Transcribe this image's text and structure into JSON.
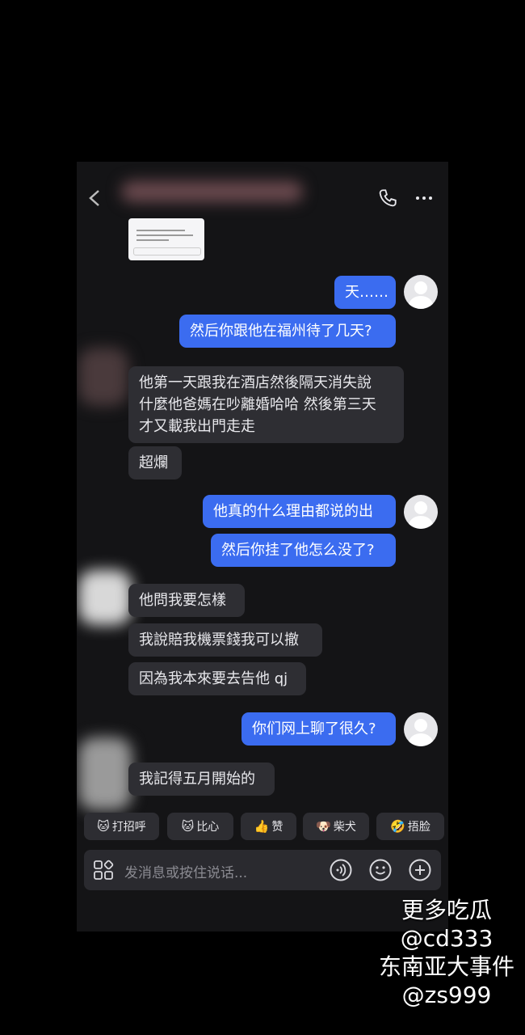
{
  "header": {
    "call_icon": "phone-icon",
    "more_icon": "ellipsis-icon"
  },
  "messages": [
    {
      "side": "out",
      "text": "天……"
    },
    {
      "side": "out",
      "text": "然后你跟他在福州待了几天?"
    },
    {
      "side": "in",
      "text": "他第一天跟我在酒店然後隔天消失說\n什麼他爸媽在吵離婚哈哈 然後第三天\n才又載我出門走走"
    },
    {
      "side": "in",
      "text": "超爛"
    },
    {
      "side": "out",
      "text": "他真的什么理由都说的出"
    },
    {
      "side": "out",
      "text": "然后你挂了他怎么没了?"
    },
    {
      "side": "in",
      "text": "他問我要怎樣"
    },
    {
      "side": "in",
      "text": "我說賠我機票錢我可以撤"
    },
    {
      "side": "in",
      "text": "因為我本來要去告他 qj"
    },
    {
      "side": "out",
      "text": "你们网上聊了很久?"
    },
    {
      "side": "in",
      "text": "我記得五月開始的"
    }
  ],
  "quick_replies": [
    {
      "emoji": "🐱",
      "label": "打招呼"
    },
    {
      "emoji": "🐱",
      "label": "比心"
    },
    {
      "emoji": "👍",
      "label": "赞"
    },
    {
      "emoji": "🐶",
      "label": "柴犬"
    },
    {
      "emoji": "🤣",
      "label": "捂脸"
    }
  ],
  "composer": {
    "placeholder": "发消息或按住说话...",
    "icons": [
      "apps-grid-icon",
      "voice-icon",
      "emoji-icon",
      "plus-icon"
    ]
  },
  "watermark": {
    "line1": "更多吃瓜",
    "line2": "@cd333",
    "line3": "东南亚大事件",
    "line4": "@zs999"
  },
  "colors": {
    "outgoing_bubble": "#3b6cf0",
    "incoming_bubble": "#2e2e33",
    "background": "#141416"
  }
}
